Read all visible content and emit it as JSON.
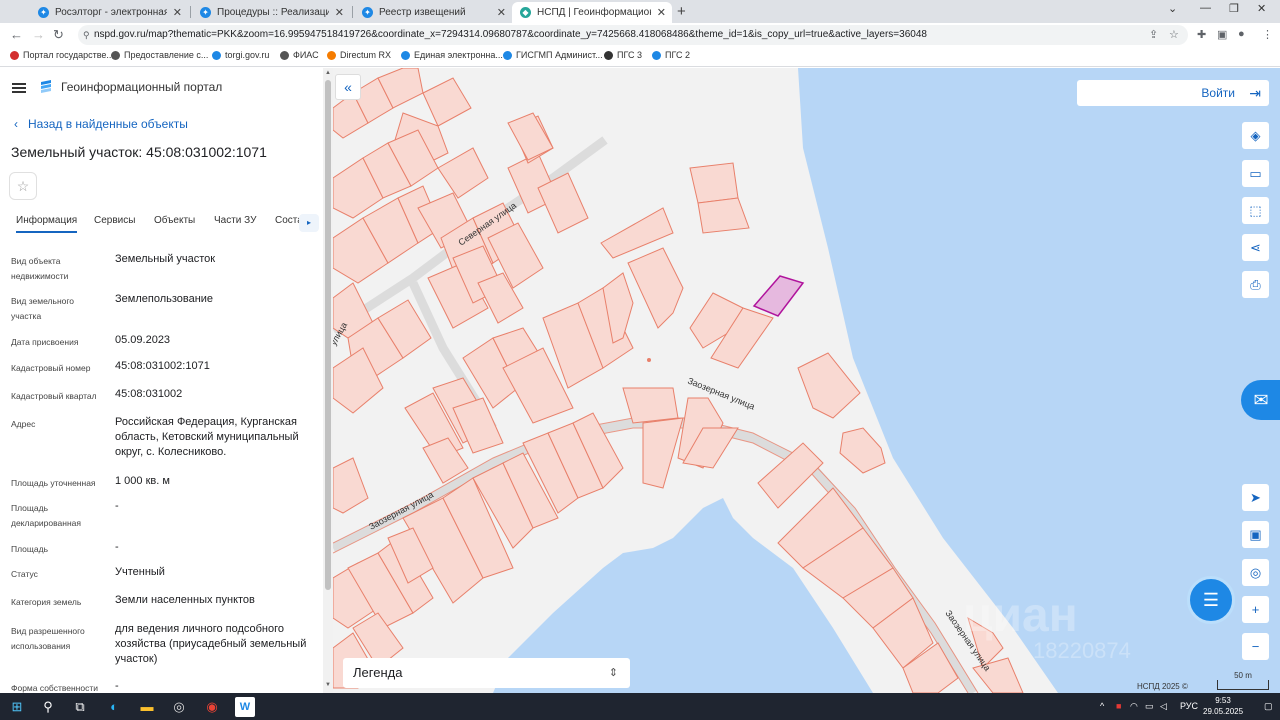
{
  "browser": {
    "tabs": [
      {
        "title": "Росэлторг - электронная торгов",
        "active": false
      },
      {
        "title": "Процедуры :: Реализация госим",
        "active": false
      },
      {
        "title": "Реестр извещений",
        "active": false
      },
      {
        "title": "НСПД | Геоинформационный п",
        "active": true
      }
    ],
    "url": "nspd.gov.ru/map?thematic=PKK&zoom=16.995947518419726&coordinate_x=7294314.09680787&coordinate_y=7425668.418068486&theme_id=1&is_copy_url=true&active_layers=36048",
    "bookmarks": [
      "Портал государстве...",
      "Предоставление с...",
      "torgi.gov.ru",
      "ФИАС",
      "Directum RX",
      "Единая электронна...",
      "ГИСГМП Админист...",
      "ПГС 3",
      "ПГС 2"
    ]
  },
  "panel": {
    "portal_title": "Геоинформационный портал",
    "back_label": "Назад в найденные объекты",
    "title": "Земельный участок: 45:08:031002:1071",
    "tabs": [
      "Информация",
      "Сервисы",
      "Объекты",
      "Части ЗУ",
      "Соста"
    ],
    "fields": [
      {
        "label": "Вид объекта недвижимости",
        "value": "Земельный участок"
      },
      {
        "label": "Вид земельного участка",
        "value": "Землепользование"
      },
      {
        "label": "Дата присвоения",
        "value": "05.09.2023"
      },
      {
        "label": "Кадастровый номер",
        "value": "45:08:031002:1071"
      },
      {
        "label": "Кадастровый квартал",
        "value": "45:08:031002"
      },
      {
        "label": "Адрес",
        "value": "Российская Федерация, Курганская область, Кетовский муниципальный округ, с. Колесниково."
      },
      {
        "label": "Площадь уточненная",
        "value": "1 000 кв. м"
      },
      {
        "label": "Площадь декларированная",
        "value": "-"
      },
      {
        "label": "Площадь",
        "value": "-"
      },
      {
        "label": "Статус",
        "value": "Учтенный"
      },
      {
        "label": "Категория земель",
        "value": "Земли населенных пунктов"
      },
      {
        "label": "Вид разрешенного использования",
        "value": "для ведения личного подсобного хозяйства (приусадебный земельный участок)"
      },
      {
        "label": "Форма собственности",
        "value": "-"
      }
    ]
  },
  "map": {
    "login_label": "Войти",
    "legend_label": "Легенда",
    "copyright": "НСПД 2025 ©",
    "scale": "50 m",
    "watermark": "циан",
    "watermark_phone": "18220874",
    "street_labels": [
      "Северная улица",
      "Заозерная улица",
      "Заозерная улица",
      "Заозерная улица",
      "улица"
    ],
    "colors": {
      "water": "#b7d6f6",
      "land": "#f2f2f2",
      "parcel_fill": "#f9d9d2",
      "parcel_stroke": "#e8806b",
      "selected_fill": "#e6b9df",
      "selected_stroke": "#b0139c",
      "accent": "#1565c0"
    }
  },
  "taskbar": {
    "language": "РУС",
    "time": "9:53",
    "date": "29.05.2025"
  }
}
